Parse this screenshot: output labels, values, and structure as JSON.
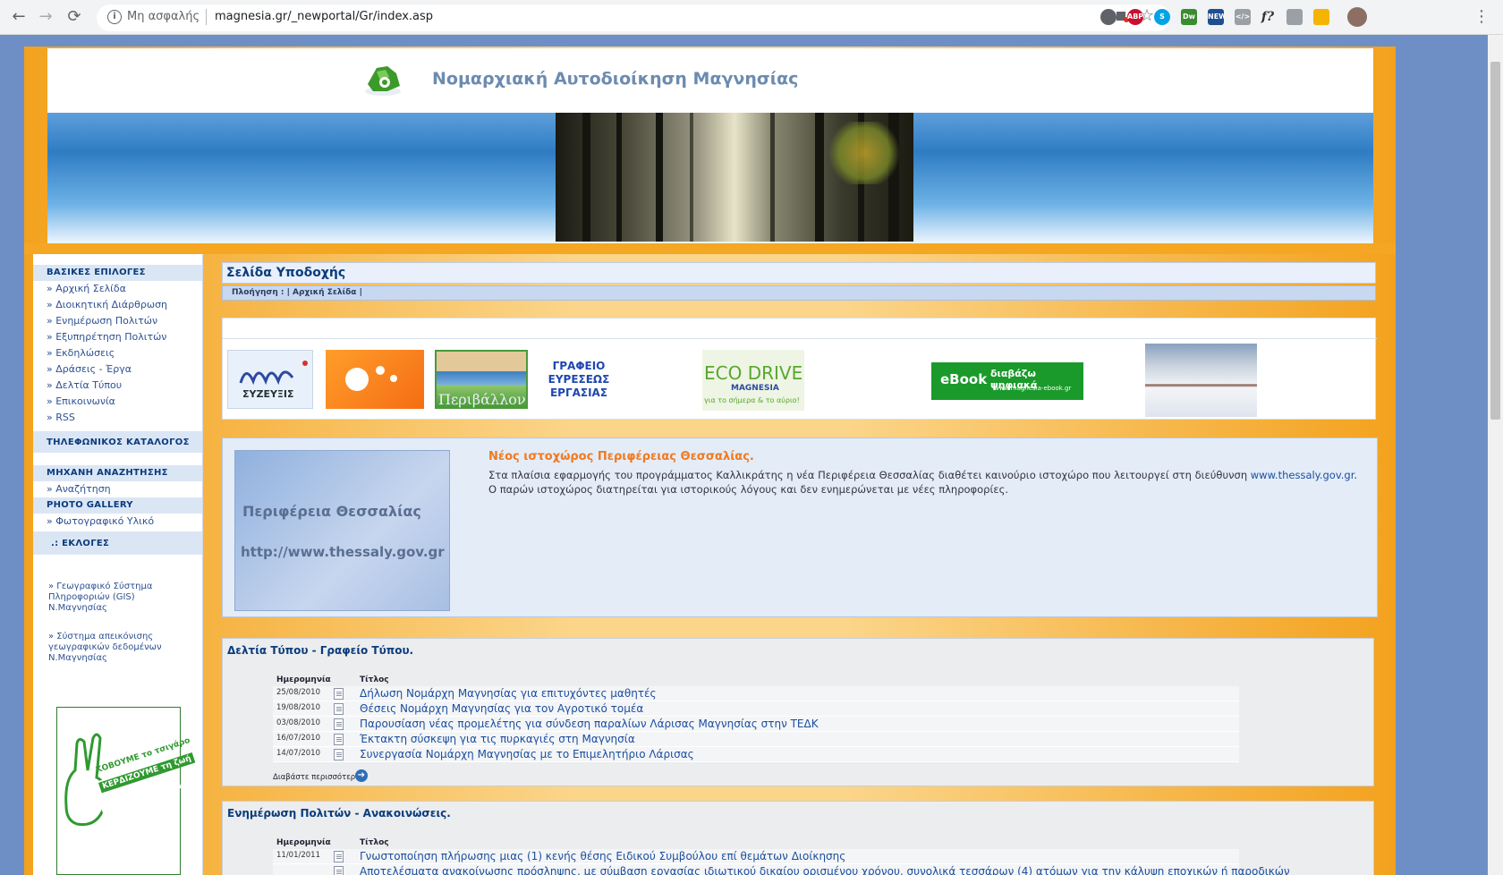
{
  "browser": {
    "back_icon": "←",
    "forward_icon": "→",
    "reload_icon": "⟳",
    "info_icon": "i",
    "security_label": "Μη ασφαλής",
    "url": "magnesia.gr/_newportal/Gr/index.asp",
    "star_icon": "☆",
    "menu_icon": "⋮",
    "extensions": [
      {
        "label": "ABP",
        "color": "#c8102e"
      },
      {
        "label": "S",
        "color": "#00a4e4"
      },
      {
        "label": "Dw",
        "color": "#3a8c2f"
      },
      {
        "label": "NEW",
        "color": "#1f4f8f"
      },
      {
        "label": "</>",
        "color": "#9aa0a6"
      },
      {
        "label": "f?",
        "color": "#f1f3f4"
      }
    ]
  },
  "header": {
    "title": "Νομαρχιακή Αυτοδιοίκηση Μαγνησίας"
  },
  "sidebar": {
    "section_basic": "ΒΑΣΙΚΕΣ ΕΠΙΛΟΓΕΣ",
    "basic_items": [
      "» Αρχική Σελίδα",
      "» Διοικητική Διάρθρωση",
      "» Ενημέρωση Πολιτών",
      "» Εξυπηρέτηση Πολιτών",
      "» Εκδηλώσεις",
      "» Δράσεις - Έργα",
      "» Δελτία Τύπου",
      "» Επικοινωνία",
      "» RSS"
    ],
    "section_phone": "ΤΗΛΕΦΩΝΙΚΟΣ ΚΑΤΑΛΟΓΟΣ",
    "section_search": "ΜΗΧΑΝΗ ΑΝΑΖΗΤΗΣΗΣ",
    "search_item": "» Αναζήτηση",
    "section_photo": "PHOTO GALLERY",
    "photo_item": "» Φωτογραφικό Υλικό",
    "section_elections": ".: ΕΚΛΟΓΕΣ",
    "gis_link": "» Γεωγραφικό Σύστημα Πληροφοριών (GIS) Ν.Μαγνησίας",
    "geo_link": "» Σύστημα απεικόνισης γεωγραφικών δεδομένων Ν.Μαγνησίας",
    "ad_text1": "ΚΟΒΟΥΜΕ το τσιγάρο",
    "ad_text2": "ΚΕΡΔΙΖΟΥΜΕ τη ζωή"
  },
  "main": {
    "page_title": "Σελίδα Υποδοχής",
    "breadcrumb": "Πλοήγηση : | Αρχική Σελίδα |",
    "logos": {
      "syzefxis": "ΣΥΖΕΥΞΙΣ",
      "office": "ΓΡΑΦΕΙΟ ΕΥΡΕΣΕΩΣ ΕΡΓΑΣΙΑΣ",
      "environment": "Περιβάλλον",
      "ecodrive": "ECO DRIVE",
      "ecodrive_sub": "MAGNESIA",
      "ecodrive_slogan": "για το σήμερα & το αύριο!",
      "ebook": "eBook",
      "ebook_text": "διαβάζω ψηφιακά",
      "ebook_url": "www.magnesia-ebook.gr"
    },
    "news": {
      "image_line1": "Περιφέρεια Θεσσαλίας",
      "image_line2": "http://www.thessaly.gov.gr",
      "title": "Νέος ιστοχώρος Περιφέρειας Θεσσαλίας.",
      "text_before": "Στα πλαίσια εφαρμογής του προγράμματος Καλλικράτης η νέα Περιφέρεια Θεσσαλίας διαθέτει καινούριο ιστοχώρο που λειτουργεί στη διεύθυνση ",
      "text_link": "www.thessaly.gov.gr",
      "text_after": ". Ο παρών ιστοχώρος διατηρείται για ιστορικούς λόγους και δεν ενημερώνεται με νέες πληροφορίες."
    },
    "press": {
      "title": "Δελτία Τύπου - Γραφείο Τύπου.",
      "col_date": "Ημερομηνία",
      "col_title": "Τίτλος",
      "rows": [
        {
          "date": "25/08/2010",
          "title": "Δήλωση Νομάρχη Μαγνησίας για επιτυχόντες μαθητές"
        },
        {
          "date": "19/08/2010",
          "title": "Θέσεις Νομάρχη Μαγνησίας για τον Αγροτικό τομέα"
        },
        {
          "date": "03/08/2010",
          "title": "Παρουσίαση νέας προμελέτης για σύνδεση παραλίων Λάρισας Μαγνησίας στην ΤΕΔΚ"
        },
        {
          "date": "16/07/2010",
          "title": "Έκτακτη σύσκεψη για τις πυρκαγιές στη Μαγνησία"
        },
        {
          "date": "14/07/2010",
          "title": "Συνεργασία Νομάρχη Μαγνησίας με το Επιμελητήριο Λάρισας"
        }
      ],
      "more_label": "Διαβάστε περισσότερα"
    },
    "citizens": {
      "title": "Ενημέρωση Πολιτών - Ανακοινώσεις.",
      "col_date": "Ημερομηνία",
      "col_title": "Τίτλος",
      "rows": [
        {
          "date": "11/01/2011",
          "title": "Γνωστοποίηση πλήρωσης μιας (1) κενής θέσης Ειδικού Συμβούλου επί θεμάτων Διοίκησης"
        },
        {
          "date": "",
          "title": "Αποτελέσματα ανακοίνωσης πρόσληψης, με σύμβαση εργασίας ιδιωτικού δικαίου ορισμένου χρόνου, συνολικά τεσσάρων (4) ατόμων για την κάλυψη εποχικών ή παροδικών"
        }
      ]
    }
  }
}
